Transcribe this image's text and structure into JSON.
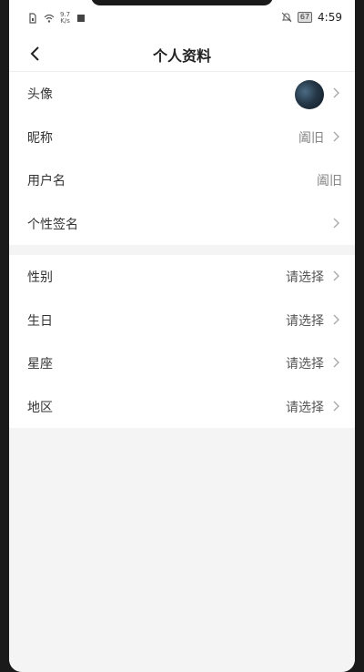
{
  "status_bar": {
    "net_speed_value": "9.7",
    "net_speed_unit": "K/s",
    "battery": "67",
    "time": "4:59"
  },
  "header": {
    "title": "个人资料"
  },
  "profile_group": [
    {
      "label": "头像",
      "value": ""
    },
    {
      "label": "昵称",
      "value": "阖旧"
    },
    {
      "label": "用户名",
      "value": "阖旧"
    },
    {
      "label": "个性签名",
      "value": ""
    }
  ],
  "info_group": [
    {
      "label": "性别",
      "value": "请选择"
    },
    {
      "label": "生日",
      "value": "请选择"
    },
    {
      "label": "星座",
      "value": "请选择"
    },
    {
      "label": "地区",
      "value": "请选择"
    }
  ]
}
